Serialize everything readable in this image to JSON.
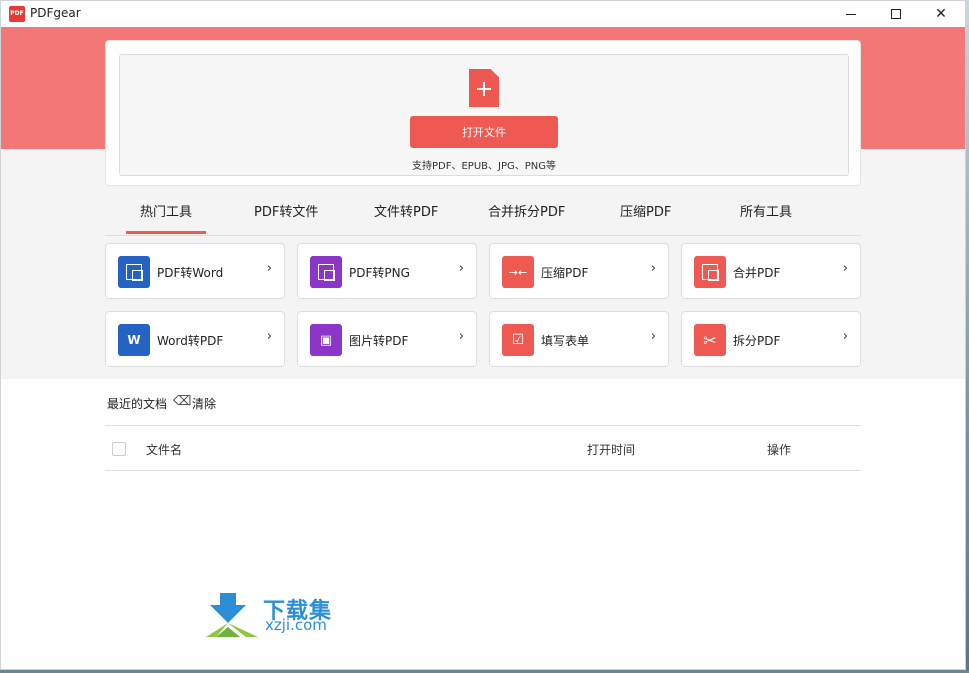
{
  "window": {
    "title": "PDFgear",
    "logo_text": "PDF"
  },
  "controls": {
    "minimize": "minimize",
    "maximize": "maximize",
    "close": "✕"
  },
  "upload": {
    "open_button": "打开文件",
    "support_text": "支持PDF、EPUB、JPG、PNG等"
  },
  "tabs": [
    {
      "label": "热门工具",
      "active": true
    },
    {
      "label": "PDF转文件"
    },
    {
      "label": "文件转PDF"
    },
    {
      "label": "合并拆分PDF"
    },
    {
      "label": "压缩PDF"
    },
    {
      "label": "所有工具"
    }
  ],
  "tools": [
    {
      "label": "PDF转Word",
      "icon": "pdf-to-word-icon",
      "color": "#2463c4"
    },
    {
      "label": "PDF转PNG",
      "icon": "pdf-to-png-icon",
      "color": "#8b35c9"
    },
    {
      "label": "压缩PDF",
      "icon": "compress-icon",
      "color": "#ee5a52"
    },
    {
      "label": "合并PDF",
      "icon": "merge-icon",
      "color": "#ee5a52"
    },
    {
      "label": "Word转PDF",
      "icon": "word-to-pdf-icon",
      "color": "#2463c4"
    },
    {
      "label": "图片转PDF",
      "icon": "image-to-pdf-icon",
      "color": "#8b35c9"
    },
    {
      "label": "填写表单",
      "icon": "fill-form-icon",
      "color": "#ee5a52"
    },
    {
      "label": "拆分PDF",
      "icon": "split-icon",
      "color": "#ee5a52"
    }
  ],
  "recent": {
    "title": "最近的文档",
    "clear": "清除",
    "columns": {
      "name": "文件名",
      "time": "打开时间",
      "action": "操作"
    }
  },
  "watermark": {
    "cn": "下载集",
    "url": "xzji.com"
  },
  "colors": {
    "accent": "#ee5a52",
    "hero": "#f37777",
    "blue": "#2463c4",
    "purple": "#8b35c9"
  }
}
